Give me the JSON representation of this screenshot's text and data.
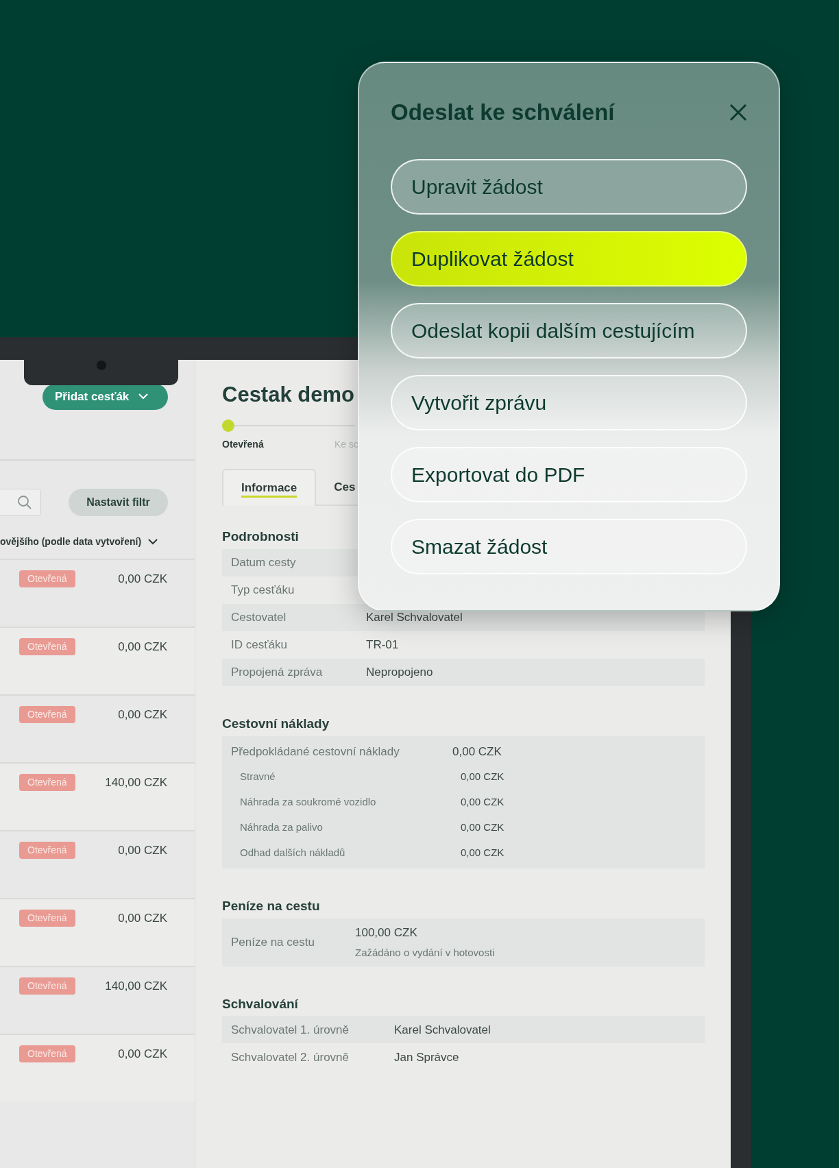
{
  "sidebar": {
    "add_button": "Přidat cesťák",
    "filter_button": "Nastavit filtr",
    "sort_label": "ovějšího (podle data vytvoření)",
    "rows": [
      {
        "status": "Otevřená",
        "amount": "0,00 CZK"
      },
      {
        "status": "Otevřená",
        "amount": "0,00 CZK"
      },
      {
        "status": "Otevřená",
        "amount": "0,00 CZK"
      },
      {
        "status": "Otevřená",
        "amount": "140,00 CZK"
      },
      {
        "status": "Otevřená",
        "amount": "0,00 CZK"
      },
      {
        "status": "Otevřená",
        "amount": "0,00 CZK"
      },
      {
        "status": "Otevřená",
        "amount": "140,00 CZK"
      },
      {
        "status": "Otevřená",
        "amount": "0,00 CZK"
      }
    ]
  },
  "detail": {
    "title": "Cestak demo",
    "steps": [
      {
        "label": "Otevřená",
        "selected": true
      },
      {
        "label": "Ke sc",
        "selected": false
      }
    ],
    "tabs": [
      {
        "label": "Informace",
        "selected": true
      },
      {
        "label": "Ces",
        "selected": false
      }
    ],
    "sections": [
      {
        "kind": "details",
        "heading": "Podrobnosti",
        "rows": [
          {
            "label": "Datum cesty"
          },
          {
            "label": "Typ cesťáku"
          },
          {
            "label": "Cestovatel",
            "value": "Karel Schvalovatel"
          },
          {
            "label": "ID cesťáku",
            "value": "TR-01"
          },
          {
            "label": "Propojená zpráva",
            "value": "Nepropojeno"
          }
        ]
      },
      {
        "kind": "costs",
        "heading": "Cestovní náklady",
        "rows": [
          {
            "kind": "main",
            "label": "Předpokládané cestovní náklady",
            "value": "0,00 CZK"
          },
          {
            "kind": "sub",
            "label": "Stravné",
            "value": "0,00 CZK"
          },
          {
            "kind": "sub",
            "label": "Náhrada za soukromé vozidlo",
            "value": "0,00 CZK"
          },
          {
            "kind": "sub",
            "label": "Náhrada za palivo",
            "value": "0,00 CZK"
          },
          {
            "kind": "sub",
            "label": "Odhad dalších nákladů",
            "value": "0,00 CZK"
          }
        ]
      },
      {
        "kind": "cash",
        "heading": "Peníze na cestu",
        "rows": [
          {
            "label": "Peníze na cestu",
            "value": "100,00 CZK",
            "note": "Zažádáno o vydání v hotovosti"
          }
        ]
      },
      {
        "kind": "approval",
        "heading": "Schvalování",
        "rows": [
          {
            "label": "Schvalovatel 1. úrovně",
            "value": "Karel Schvalovatel"
          },
          {
            "label": "Schvalovatel 2. úrovně",
            "value": "Jan Správce"
          }
        ]
      }
    ]
  },
  "modal": {
    "title": "Odeslat ke schválení",
    "actions": [
      {
        "label": "Upravit žádost",
        "selected": false
      },
      {
        "label": "Duplikovat žádost",
        "selected": true
      },
      {
        "label": "Odeslat kopii dalším cestujícím",
        "selected": false
      },
      {
        "label": "Vytvořit zprávu",
        "selected": false
      },
      {
        "label": "Exportovat do PDF",
        "selected": false
      },
      {
        "label": "Smazat žádost",
        "selected": false
      }
    ]
  }
}
